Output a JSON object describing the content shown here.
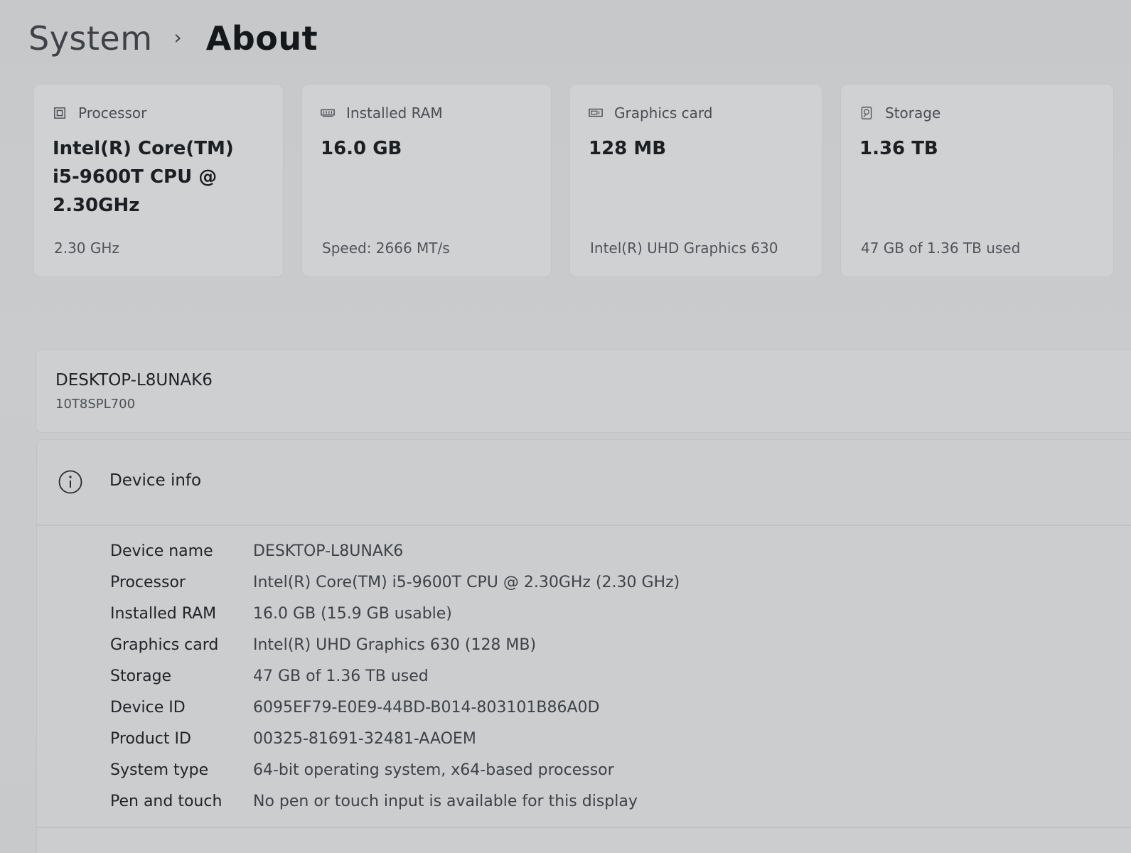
{
  "breadcrumb": {
    "parent": "System",
    "separator": "›",
    "current": "About"
  },
  "cards": [
    {
      "icon": "processor-icon",
      "title": "Processor",
      "value": "Intel(R) Core(TM) i5-9600T CPU @ 2.30GHz",
      "sub": "2.30 GHz"
    },
    {
      "icon": "ram-icon",
      "title": "Installed RAM",
      "value": "16.0 GB",
      "sub": "Speed: 2666 MT/s"
    },
    {
      "icon": "graphics-card-icon",
      "title": "Graphics card",
      "value": "128 MB",
      "sub": "Intel(R) UHD Graphics 630"
    },
    {
      "icon": "storage-icon",
      "title": "Storage",
      "value": "1.36 TB",
      "sub": "47 GB of 1.36 TB used"
    }
  ],
  "device": {
    "name": "DESKTOP-L8UNAK6",
    "model": "10T8SPL700"
  },
  "device_info": {
    "title": "Device info",
    "rows": [
      {
        "label": "Device name",
        "value": "DESKTOP-L8UNAK6"
      },
      {
        "label": "Processor",
        "value": "Intel(R) Core(TM) i5-9600T CPU @ 2.30GHz (2.30 GHz)"
      },
      {
        "label": "Installed RAM",
        "value": "16.0 GB (15.9 GB usable)"
      },
      {
        "label": "Graphics card",
        "value": "Intel(R) UHD Graphics 630 (128 MB)"
      },
      {
        "label": "Storage",
        "value": "47 GB of 1.36 TB used"
      },
      {
        "label": "Device ID",
        "value": "6095EF79-E0E9-44BD-B014-803101B86A0D"
      },
      {
        "label": "Product ID",
        "value": "00325-81691-32481-AAOEM"
      },
      {
        "label": "System type",
        "value": "64-bit operating system, x64-based processor"
      },
      {
        "label": "Pen and touch",
        "value": "No pen or touch input is available for this display"
      }
    ]
  }
}
